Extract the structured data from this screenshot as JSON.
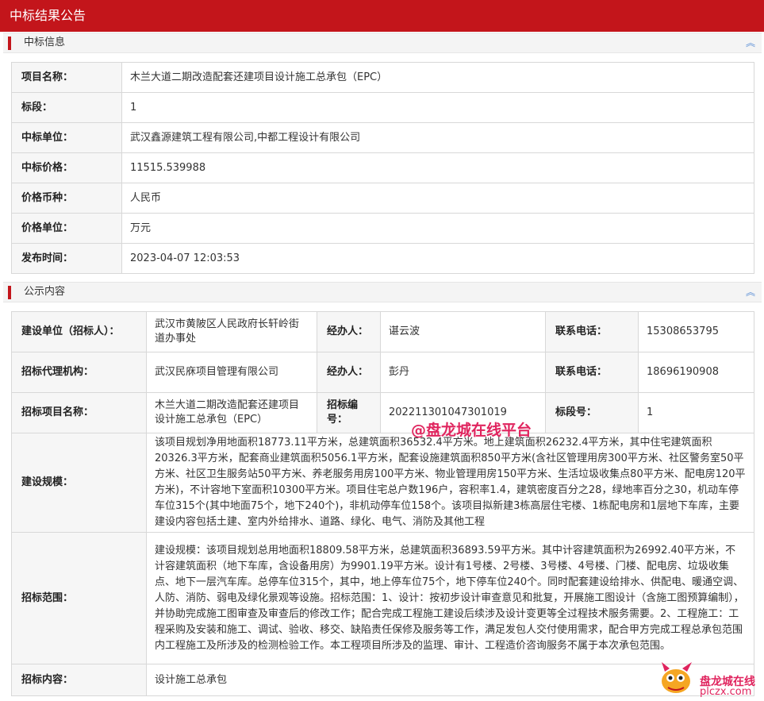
{
  "header": {
    "title": "中标结果公告"
  },
  "winning_info": {
    "section_title": "中标信息",
    "rows": [
      {
        "label": "项目名称：",
        "value": "木兰大道二期改造配套还建项目设计施工总承包（EPC）"
      },
      {
        "label": "标段：",
        "value": "1"
      },
      {
        "label": "中标单位：",
        "value": "武汉鑫源建筑工程有限公司,中都工程设计有限公司"
      },
      {
        "label": "中标价格：",
        "value": "11515.539988"
      },
      {
        "label": "价格币种：",
        "value": "人民币"
      },
      {
        "label": "价格单位：",
        "value": "万元"
      },
      {
        "label": "发布时间：",
        "value": "2023-04-07 12:03:53"
      }
    ]
  },
  "public_content": {
    "section_title": "公示内容",
    "builder": {
      "label": "建设单位（招标人）：",
      "value": "武汉市黄陂区人民政府长轩岭街道办事处",
      "handler_label": "经办人：",
      "handler": "谌云波",
      "phone_label": "联系电话：",
      "phone": "15308653795"
    },
    "agency": {
      "label": "招标代理机构：",
      "value": "武汉民庥项目管理有限公司",
      "handler_label": "经办人：",
      "handler": "彭丹",
      "phone_label": "联系电话：",
      "phone": "18696190908"
    },
    "project": {
      "label": "招标项目名称：",
      "value": "木兰大道二期改造配套还建项目设计施工总承包（EPC）",
      "number_label": "招标编号：",
      "number": "202211301047301019",
      "section_label": "标段号：",
      "section": "1"
    },
    "scale": {
      "label": "建设规模：",
      "value": "该项目规划净用地面积18773.11平方米，总建筑面积36532.4平方米。地上建筑面积26232.4平方米，其中住宅建筑面积20326.3平方米，配套商业建筑面积5056.1平方米，配套设施建筑面积850平方米(含社区管理用房300平方米、社区警务室50平方米、社区卫生服务站50平方米、养老服务用房100平方米、物业管理用房150平方米、生活垃圾收集点80平方米、配电房120平方米)，不计容地下室面积10300平方米。项目住宅总户数196户，容积率1.4，建筑密度百分之28，绿地率百分之30，机动车停车位315个(其中地面75个，地下240个)，非机动停车位158个。该项目拟新建3栋高层住宅楼、1栋配电房和1层地下车库，主要建设内容包括土建、室内外给排水、道路、绿化、电气、消防及其他工程"
    },
    "range": {
      "label": "招标范围：",
      "value": "建设规模：该项目规划总用地面积18809.58平方米，总建筑面积36893.59平方米。其中计容建筑面积为26992.40平方米，不计容建筑面积（地下车库，含设备用房）为9901.19平方米。设计有1号楼、2号楼、3号楼、4号楼、门楼、配电房、垃圾收集点、地下一层汽车库。总停车位315个，其中，地上停车位75个，地下停车位240个。同时配套建设给排水、供配电、暖通空调、人防、消防、弱电及绿化景观等设施。招标范围：1、设计：按初步设计审查意见和批复，开展施工图设计（含施工图预算编制），并协助完成施工图审查及审查后的修改工作；配合完成工程施工建设后续涉及设计变更等全过程技术服务需要。2、工程施工：工程采购及安装和施工、调试、验收、移交、缺陷责任保修及服务等工作，满足发包人交付使用需求，配合甲方完成工程总承包范围内工程施工及所涉及的检测检验工作。本工程项目所涉及的监理、审计、工程造价咨询服务不属于本次承包范围。"
    },
    "content": {
      "label": "招标内容：",
      "value": "设计施工总承包"
    }
  },
  "watermark": {
    "text": "@盘龙城在线平台"
  },
  "logo": {
    "brand": "盘龙城在线",
    "domain": "plczx.com"
  },
  "icons": {
    "collapse": "double-chevron-up-icon",
    "mascot": "dragon-mascot-icon"
  },
  "colors": {
    "brand_red": "#c3151b",
    "watermark_pink": "#e0245e",
    "collapse_blue": "#5b8fd6"
  }
}
